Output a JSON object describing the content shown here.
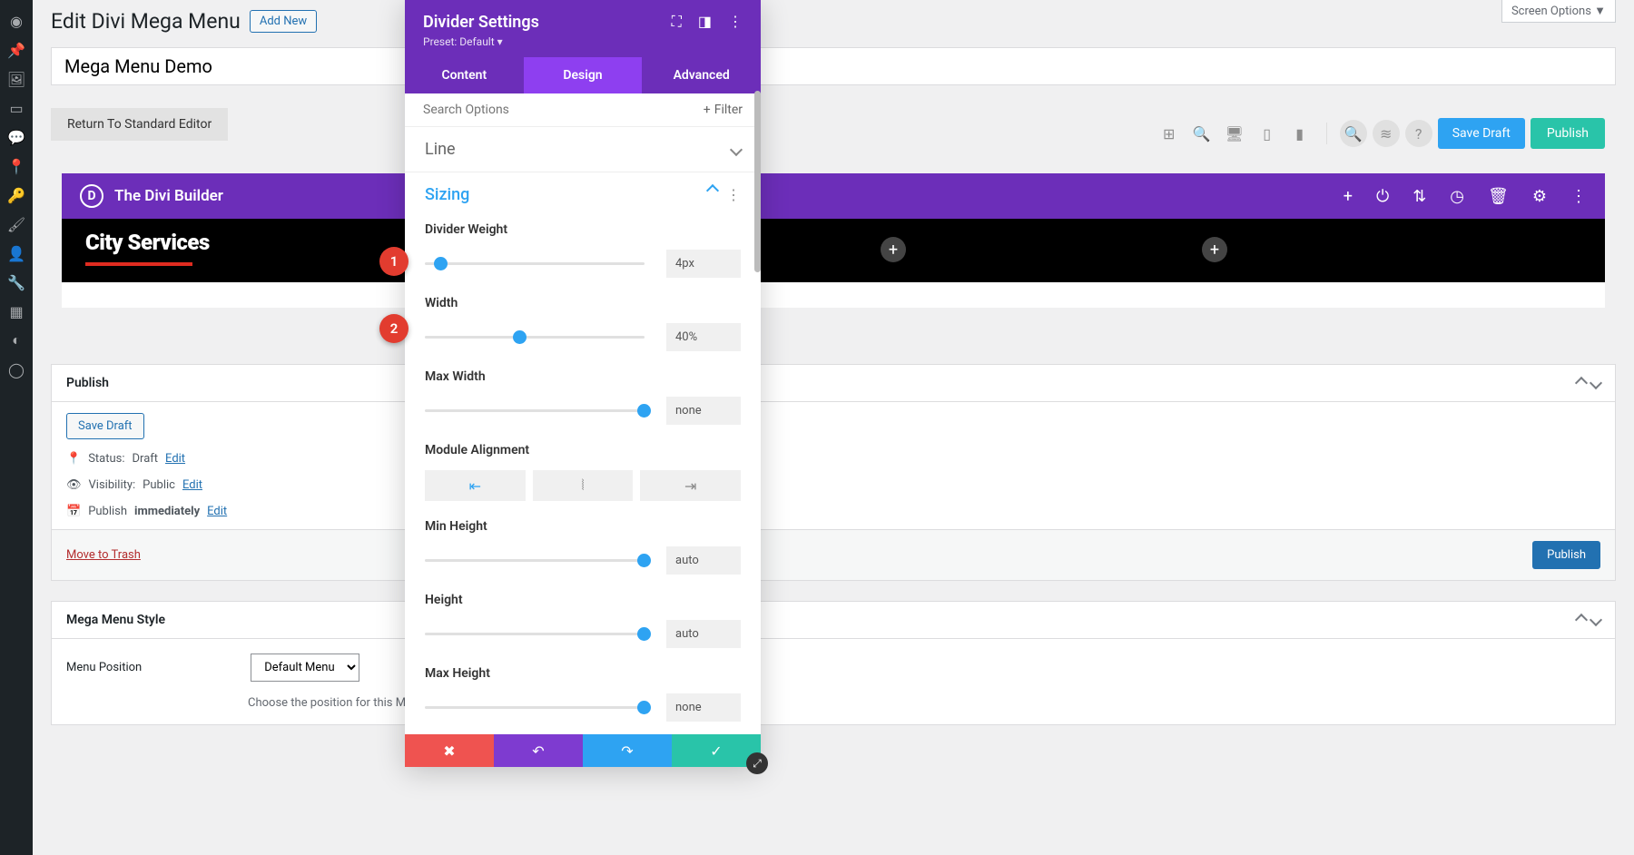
{
  "page": {
    "heading": "Edit Divi Mega Menu",
    "add_new": "Add New",
    "title_value": "Mega Menu Demo",
    "return_btn": "Return To Standard Editor",
    "screen_options": "Screen Options ▼"
  },
  "toolbar": {
    "save_draft": "Save Draft",
    "publish": "Publish"
  },
  "builder": {
    "title": "The Divi Builder",
    "section_label": "City Services"
  },
  "publish_box": {
    "title": "Publish",
    "save_draft": "Save Draft",
    "status_label": "Status:",
    "status_value": "Draft",
    "visibility_label": "Visibility:",
    "visibility_value": "Public",
    "publish_label": "Publish",
    "publish_when": "immediately",
    "edit": "Edit",
    "trash": "Move to Trash",
    "publish_btn": "Publish"
  },
  "style_box": {
    "title": "Mega Menu Style",
    "position_label": "Menu Position",
    "position_value": "Default Menu",
    "help": "Choose the position for this Mega."
  },
  "modal": {
    "title": "Divider Settings",
    "preset": "Preset: Default ▾",
    "tabs": {
      "content": "Content",
      "design": "Design",
      "advanced": "Advanced"
    },
    "search_placeholder": "Search Options",
    "filter": "Filter",
    "sections": {
      "line": "Line",
      "sizing": "Sizing"
    },
    "fields": {
      "divider_weight": {
        "label": "Divider Weight",
        "value": "4px",
        "pos": 4
      },
      "width": {
        "label": "Width",
        "value": "40%",
        "pos": 40
      },
      "max_width": {
        "label": "Max Width",
        "value": "none",
        "pos": 100
      },
      "module_alignment": {
        "label": "Module Alignment"
      },
      "min_height": {
        "label": "Min Height",
        "value": "auto",
        "pos": 100
      },
      "height": {
        "label": "Height",
        "value": "auto",
        "pos": 100
      },
      "max_height": {
        "label": "Max Height",
        "value": "none",
        "pos": 100
      }
    }
  },
  "annotations": {
    "a1": "1",
    "a2": "2"
  }
}
